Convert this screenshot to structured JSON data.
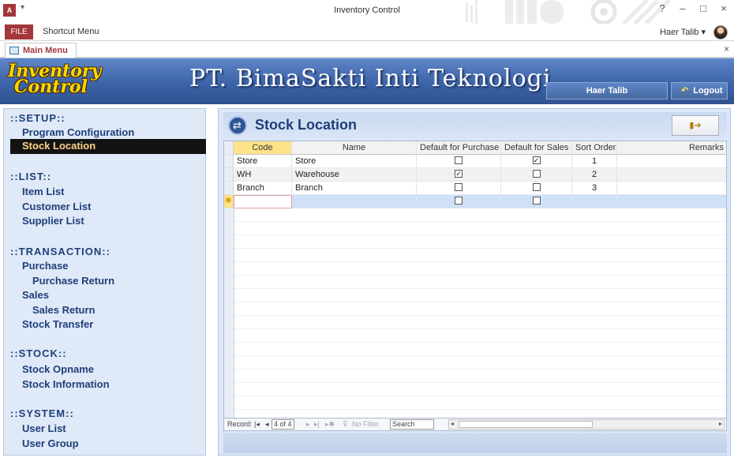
{
  "window": {
    "title": "Inventory Control",
    "app_icon": "A",
    "controls": [
      "?",
      "–",
      "□",
      "×"
    ]
  },
  "ribbon": {
    "file_tab": "FILE",
    "shortcut_menu": "Shortcut Menu",
    "user": "Haer Talib",
    "user_dropdown": "▾"
  },
  "doc_tab": {
    "label": "Main Menu",
    "close": "×"
  },
  "header": {
    "logo_line1": "Inventory",
    "logo_line2": "Control",
    "company": "PT. BimaSakti Inti Teknologi",
    "user_label": "Haer Talib",
    "logout_label": "Logout"
  },
  "sidebar": {
    "setup": "::SETUP::",
    "program_configuration": "Program Configuration",
    "stock_location": "Stock Location",
    "list": "::LIST::",
    "item_list": "Item List",
    "customer_list": "Customer List",
    "supplier_list": "Supplier List",
    "transaction": "::TRANSACTION::",
    "purchase": "Purchase",
    "purchase_return": "Purchase Return",
    "sales": "Sales",
    "sales_return": "Sales Return",
    "stock_transfer": "Stock Transfer",
    "stock": "::STOCK::",
    "stock_opname": "Stock Opname",
    "stock_information": "Stock Information",
    "system": "::SYSTEM::",
    "user_list": "User List",
    "user_group": "User Group"
  },
  "form": {
    "title": "Stock Location",
    "columns": {
      "code": "Code",
      "name": "Name",
      "default_purchase": "Default for Purchase",
      "default_sales": "Default for Sales",
      "sort_order": "Sort Order",
      "remarks": "Remarks"
    },
    "rows": [
      {
        "code": "Store",
        "name": "Store",
        "default_purchase": false,
        "default_sales": true,
        "sort_order": "1",
        "remarks": ""
      },
      {
        "code": "WH",
        "name": "Warehouse",
        "default_purchase": true,
        "default_sales": false,
        "sort_order": "2",
        "remarks": ""
      },
      {
        "code": "Branch",
        "name": "Branch",
        "default_purchase": false,
        "default_sales": false,
        "sort_order": "3",
        "remarks": ""
      }
    ],
    "new_row_marker": "✱",
    "check_mark": "✓"
  },
  "navigation": {
    "record_label": "Record:",
    "first": "|◂",
    "prev": "◂",
    "current": "4 of 4",
    "next": "▸",
    "last": "▸|",
    "new": "▸✱",
    "no_filter": "No Filter",
    "search": "Search"
  }
}
